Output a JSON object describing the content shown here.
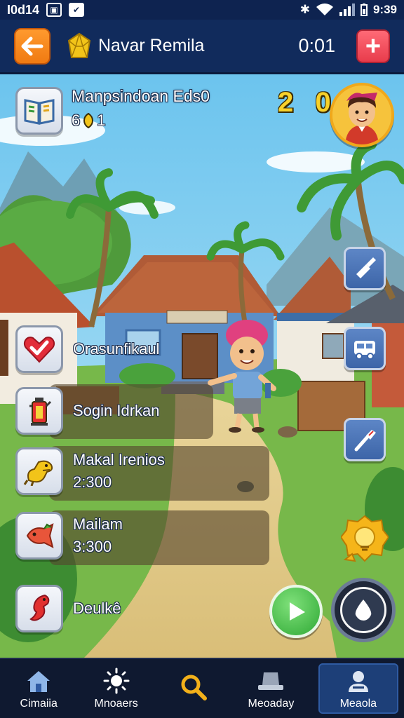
{
  "status_bar": {
    "left_text": "I0d14",
    "time": "9:39"
  },
  "header": {
    "back_icon": "back-arrow-icon",
    "title": "Navar Remila",
    "timer": "0:01",
    "add_icon": "plus-icon"
  },
  "quest": {
    "title": "Manpsindoan Eds0",
    "progress_a": "6",
    "progress_b": "1",
    "score": "2 0"
  },
  "list": [
    {
      "icon": "heart-check-icon",
      "label": "Orasunfikaul",
      "value": ""
    },
    {
      "icon": "lantern-icon",
      "label": "Sogin Idrkan",
      "value": ""
    },
    {
      "icon": "dinosaur-icon",
      "label": "Makal Irenios",
      "value": "2:300"
    },
    {
      "icon": "fish-icon",
      "label": "Mailam",
      "value": "3:300"
    },
    {
      "icon": "seahorse-icon",
      "label": "Deulkê",
      "value": ""
    }
  ],
  "tools": [
    "flashlight-icon",
    "vehicle-icon",
    "brush-icon"
  ],
  "colors": {
    "header_bg": "#112b5c",
    "accent_orange": "#f07a12",
    "accent_red": "#e83c4c",
    "score_yellow": "#f7d12a",
    "nav_bg": "#0f1930",
    "nav_active": "#1d3f78"
  },
  "bottom_nav": [
    {
      "icon": "home-icon",
      "label": "Cimaiia"
    },
    {
      "icon": "sun-icon",
      "label": "Mnoaers"
    },
    {
      "icon": "search-icon",
      "label": ""
    },
    {
      "icon": "hat-icon",
      "label": "Meoaday"
    },
    {
      "icon": "profile-icon",
      "label": "Meaola",
      "active": true
    }
  ]
}
